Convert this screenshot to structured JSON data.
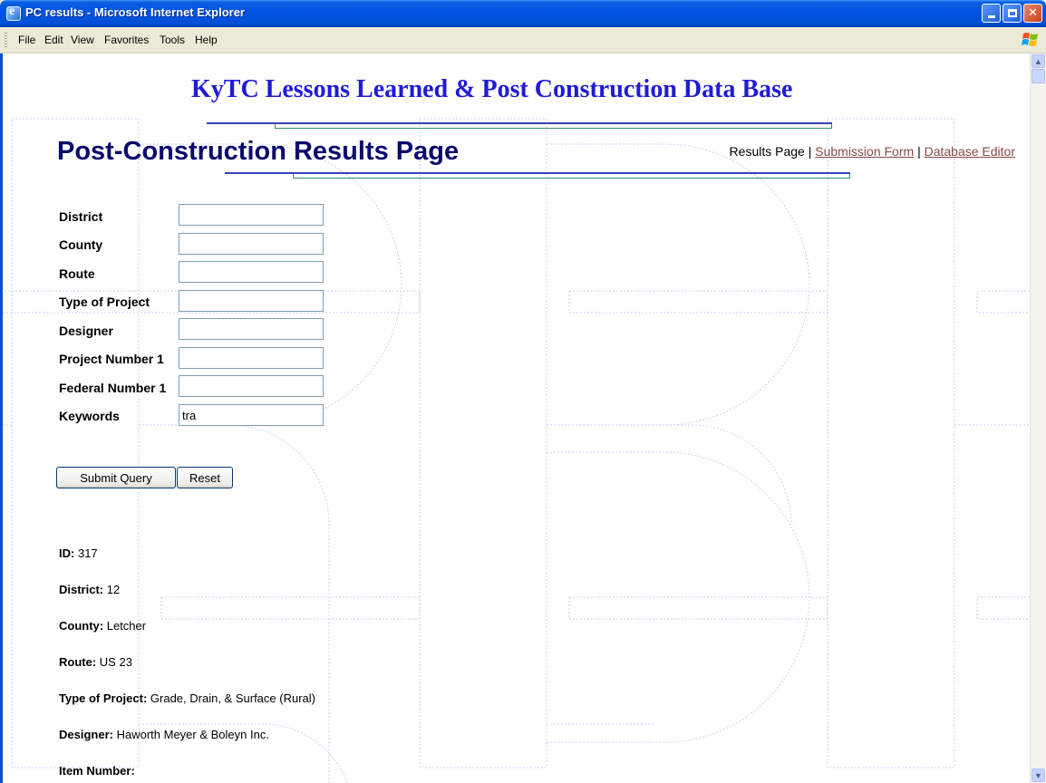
{
  "window": {
    "title": "PC results - Microsoft Internet Explorer"
  },
  "menu": [
    "File",
    "Edit",
    "View",
    "Favorites",
    "Tools",
    "Help"
  ],
  "page": {
    "site_title": "KyTC Lessons Learned & Post Construction Data Base",
    "heading": "Post-Construction Results Page",
    "nav": {
      "current": "Results Page",
      "separator": "|",
      "submission_form": "Submission Form",
      "database_editor": "Database Editor"
    }
  },
  "form": {
    "fields": [
      {
        "label": "District",
        "value": ""
      },
      {
        "label": "County",
        "value": ""
      },
      {
        "label": "Route",
        "value": ""
      },
      {
        "label": "Type of Project",
        "value": ""
      },
      {
        "label": "Designer",
        "value": ""
      },
      {
        "label": "Project Number 1",
        "value": ""
      },
      {
        "label": "Federal Number 1",
        "value": ""
      },
      {
        "label": "Keywords",
        "value": "tra"
      }
    ],
    "submit_label": "Submit Query",
    "reset_label": "Reset"
  },
  "result": [
    {
      "label": "ID:",
      "value": "317"
    },
    {
      "label": "District:",
      "value": " 12"
    },
    {
      "label": "County:",
      "value": "Letcher"
    },
    {
      "label": "Route:",
      "value": "US 23"
    },
    {
      "label": "Type of Project:",
      "value": "Grade, Drain, & Surface (Rural)"
    },
    {
      "label": "Designer:",
      "value": "Haworth Meyer & Boleyn Inc."
    },
    {
      "label": "Item Number:",
      "value": ""
    }
  ],
  "colors": {
    "title_bar": "#0054e3",
    "site_title": "#1f1bd6",
    "heading": "#0a0a6b",
    "link": "#8a4848",
    "watermark": "#c9cff0"
  },
  "icons": {
    "app": "internet-explorer-icon",
    "logo": "windows-flag-icon",
    "minimize": "minimize-icon",
    "maximize": "maximize-icon",
    "close": "close-icon"
  }
}
